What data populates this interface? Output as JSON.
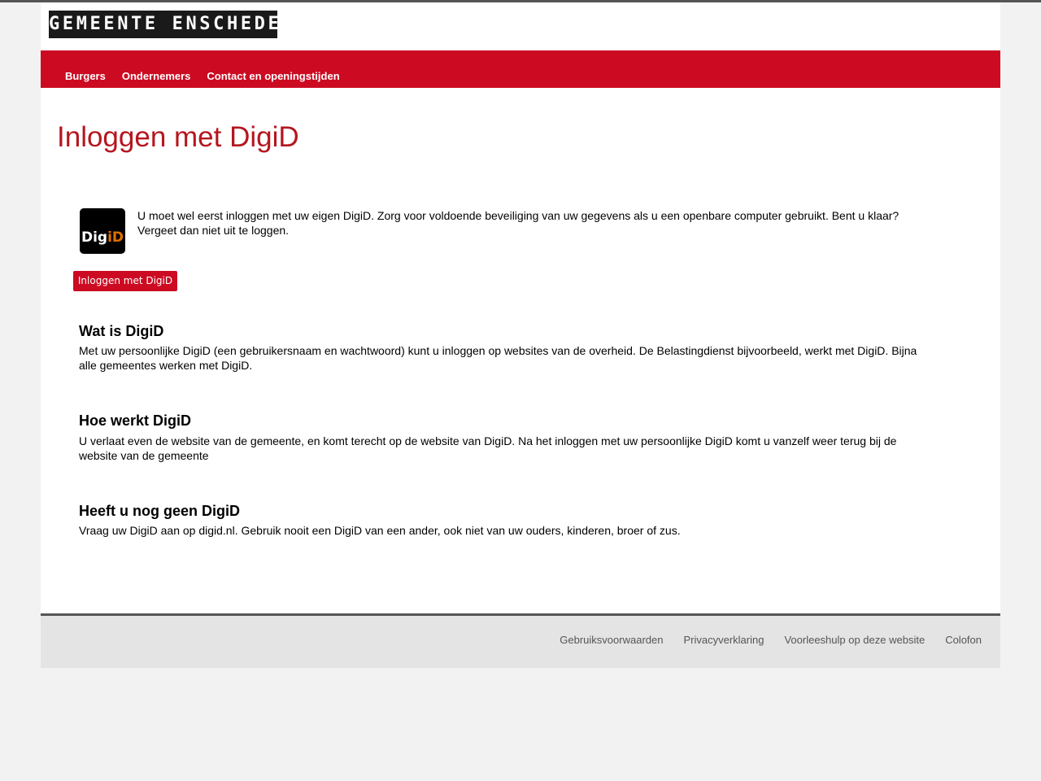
{
  "header": {
    "logo_text": "GEMEENTE ENSCHEDE"
  },
  "nav": {
    "items": [
      {
        "label": "Burgers"
      },
      {
        "label": "Ondernemers"
      },
      {
        "label": "Contact en openingstijden"
      }
    ]
  },
  "main": {
    "title": "Inloggen met DigiD",
    "digid_logo": {
      "part1": "Dig",
      "part2": "iD"
    },
    "intro_text": "U moet wel eerst inloggen met uw eigen DigiD. Zorg voor voldoende beveiliging van uw gegevens als u een openbare computer gebruikt. Bent u klaar? Vergeet dan niet uit te loggen.",
    "login_button": "Inloggen met DigiD",
    "sections": [
      {
        "heading": "Wat is DigiD",
        "text": "Met uw persoonlijke DigiD (een gebruikersnaam en wachtwoord) kunt u inloggen op websites van de overheid. De Belastingdienst bijvoorbeeld, werkt met DigiD. Bijna alle gemeentes werken met DigiD."
      },
      {
        "heading": "Hoe werkt DigiD",
        "text": "U verlaat even de website van de gemeente, en komt terecht op de website van DigiD. Na het inloggen met uw persoonlijke DigiD komt u vanzelf weer terug bij de website van de gemeente"
      },
      {
        "heading": "Heeft u nog geen DigiD",
        "text": "Vraag uw DigiD aan op digid.nl. Gebruik nooit een DigiD van een ander, ook niet van uw ouders, kinderen, broer of zus."
      }
    ]
  },
  "footer": {
    "links": [
      {
        "label": "Gebruiksvoorwaarden"
      },
      {
        "label": "Privacyverklaring"
      },
      {
        "label": "Voorleeshulp op deze website"
      },
      {
        "label": "Colofon"
      }
    ]
  },
  "colors": {
    "brand_red": "#cc0b22",
    "title_red": "#b5161f",
    "digid_orange": "#e17000"
  }
}
